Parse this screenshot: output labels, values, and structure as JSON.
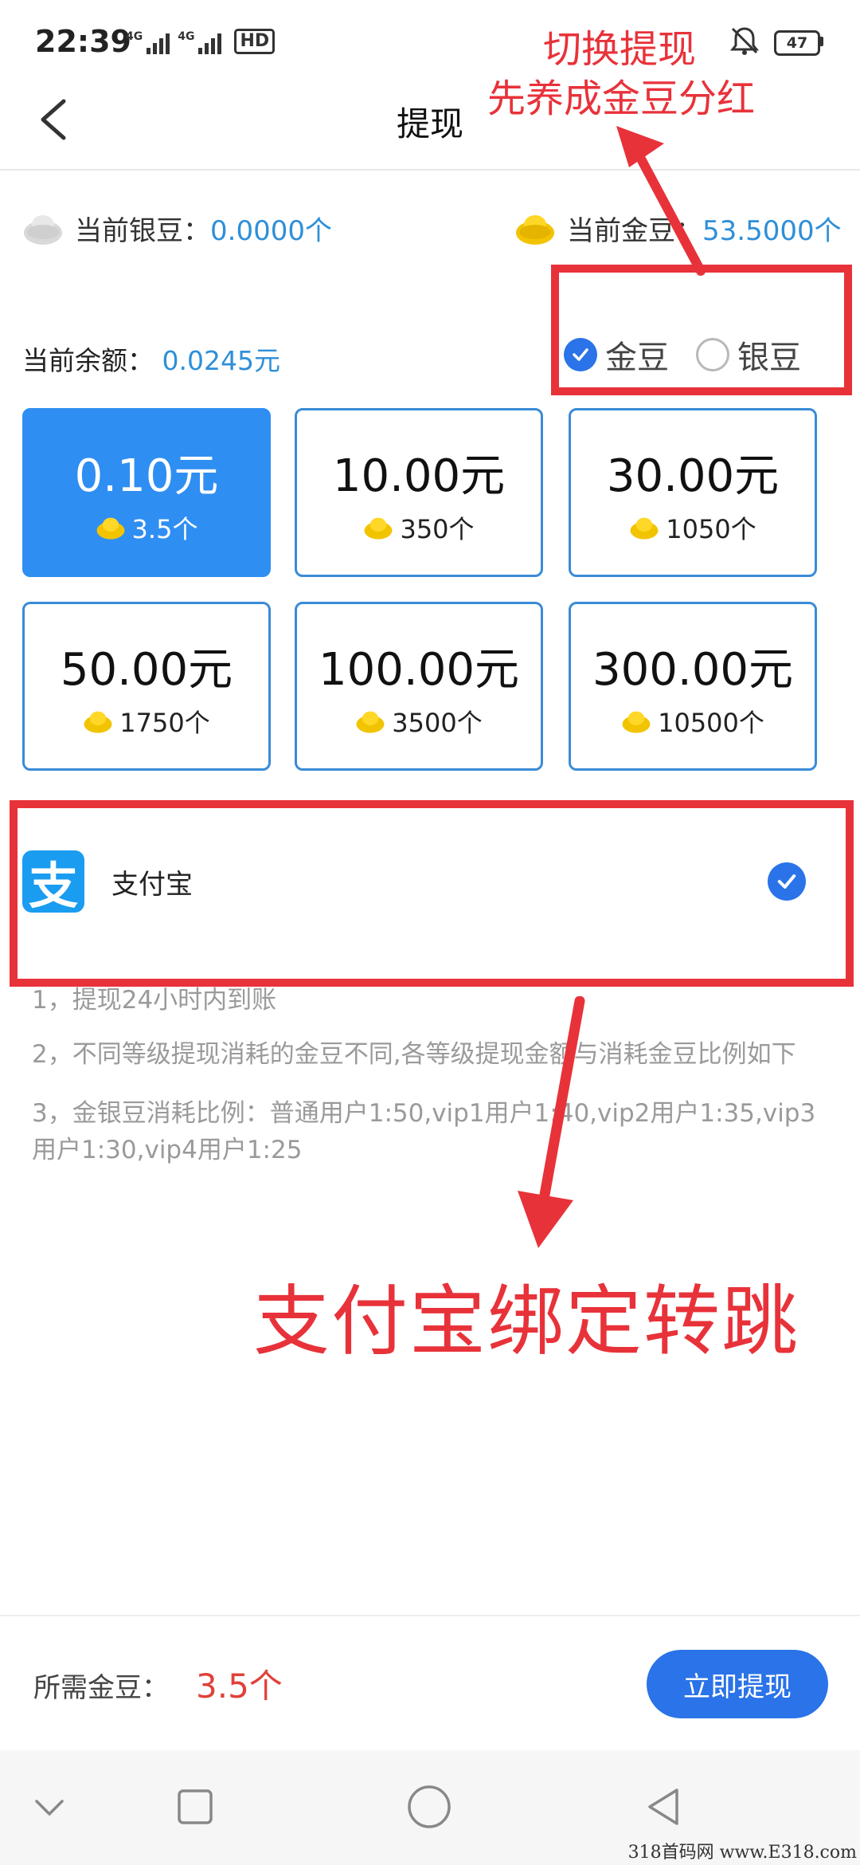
{
  "status": {
    "time": "22:39",
    "network_1": "4G",
    "network_2": "4G",
    "hd": "HD",
    "battery": "47"
  },
  "header": {
    "title": "提现"
  },
  "beans": {
    "silver_label": "当前银豆：",
    "silver_value": "0.0000个",
    "gold_label": "当前金豆：",
    "gold_value": "53.5000个"
  },
  "balance": {
    "label": "当前余额：",
    "value": "0.0245元"
  },
  "bean_type": {
    "options": [
      {
        "label": "金豆",
        "checked": true
      },
      {
        "label": "银豆",
        "checked": false
      }
    ]
  },
  "amount_options": [
    {
      "amount": "0.10元",
      "beans": "3.5个",
      "selected": true
    },
    {
      "amount": "10.00元",
      "beans": "350个",
      "selected": false
    },
    {
      "amount": "30.00元",
      "beans": "1050个",
      "selected": false
    },
    {
      "amount": "50.00元",
      "beans": "1750个",
      "selected": false
    },
    {
      "amount": "100.00元",
      "beans": "3500个",
      "selected": false
    },
    {
      "amount": "300.00元",
      "beans": "10500个",
      "selected": false
    }
  ],
  "payment": {
    "logo_char": "支",
    "label": "支付宝",
    "selected": true
  },
  "rules": [
    "1，提现24小时内到账",
    "2，不同等级提现消耗的金豆不同,各等级提现金额与消耗金豆比例如下",
    "3，金银豆消耗比例：普通用户1:50,vip1用户1:40,vip2用户1:35,vip3用户1:30,vip4用户1:25"
  ],
  "footer": {
    "required_label": "所需金豆：",
    "required_value": "3.5个",
    "withdraw_label": "立即提现"
  },
  "annotations": {
    "top_line1": "切换提现",
    "top_line2": "先养成金豆分红",
    "bottom": "支付宝绑定转跳"
  },
  "watermark": "318首码网  www.E318.com",
  "colors": {
    "accent": "#2a73e8",
    "value_blue": "#2e8fd8",
    "card_selected": "#2f8ef2",
    "alipay": "#1a9cf0",
    "annotation_red": "#e8323a",
    "required_red": "#e0413a"
  }
}
